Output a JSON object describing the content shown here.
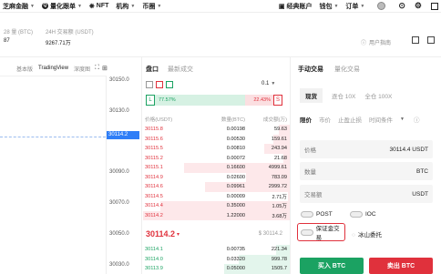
{
  "nav": {
    "items": [
      "芝麻金融",
      "量化跟单",
      "NFT",
      "机构",
      "币圈"
    ],
    "right": [
      "经典账户",
      "钱包",
      "订单"
    ]
  },
  "stats": {
    "label1": "28 量 (BTC)",
    "val1": "87",
    "label2": "24H 交易额 (USDT)",
    "val2": "9267.71万",
    "guide": "用户指南"
  },
  "chart": {
    "tabs": [
      "基本版",
      "TradingView",
      "深度图"
    ],
    "price_ticks": [
      "30150.0",
      "30130.0",
      "30114.2",
      "30090.0",
      "30070.0",
      "30050.0",
      "30030.0"
    ]
  },
  "orderbook": {
    "tabs": [
      "盘口",
      "最新成交"
    ],
    "precision": "0.1",
    "long_pct": "77.57%",
    "short_pct": "22.43%",
    "long_tag": "L",
    "short_tag": "S",
    "headers": [
      "价格(USDT)",
      "数量(BTC)",
      "成交额(万)"
    ],
    "asks": [
      {
        "price": "30115.8",
        "amount": "0.00198",
        "total": "59.63",
        "depth": 0.08
      },
      {
        "price": "30115.6",
        "amount": "0.00530",
        "total": "159.61",
        "depth": 0.12
      },
      {
        "price": "30115.5",
        "amount": "0.00810",
        "total": "243.94",
        "depth": 0.18
      },
      {
        "price": "30115.2",
        "amount": "0.00072",
        "total": "21.68",
        "depth": 0.05
      },
      {
        "price": "30115.1",
        "amount": "0.16600",
        "total": "4999.61",
        "depth": 0.72
      },
      {
        "price": "30114.9",
        "amount": "0.02600",
        "total": "783.09",
        "depth": 0.3
      },
      {
        "price": "30114.6",
        "amount": "0.09961",
        "total": "2999.72",
        "depth": 0.58
      },
      {
        "price": "30114.5",
        "amount": "0.00009",
        "total": "2.71万",
        "depth": 0.02
      },
      {
        "price": "30114.4",
        "amount": "0.35000",
        "total": "1.05万",
        "depth": 0.88
      },
      {
        "price": "30114.2",
        "amount": "1.22000",
        "total": "3.68万",
        "depth": 1.0
      }
    ],
    "last_price": "30114.2",
    "last_price_usd": "$ 30114.2",
    "bids": [
      {
        "price": "30114.1",
        "amount": "0.00735",
        "total": "221.34",
        "depth": 0.1
      },
      {
        "price": "30114.0",
        "amount": "0.03320",
        "total": "999.78",
        "depth": 0.35
      },
      {
        "price": "30113.9",
        "amount": "0.05000",
        "total": "1505.7",
        "depth": 0.45
      }
    ]
  },
  "trade": {
    "tabs": [
      "手动交易",
      "量化交易"
    ],
    "modes": [
      "现货",
      "逐仓 10X",
      "全仓 100X"
    ],
    "order_types": [
      "限价",
      "市价",
      "止盈止损",
      "时间条件"
    ],
    "price_label": "价格",
    "price_value": "30114.4 USDT",
    "qty_label": "数量",
    "qty_unit": "BTC",
    "amount_label": "交易额",
    "amount_unit": "USDT",
    "post": "POST",
    "ioc": "IOC",
    "margin_label": "保证金交易",
    "iceberg": "冰山委托",
    "buy": "买入 BTC",
    "sell": "卖出 BTC"
  },
  "colors": {
    "buy": "#1ba262",
    "sell": "#e0313c",
    "highlight_border": "#e0313c"
  }
}
